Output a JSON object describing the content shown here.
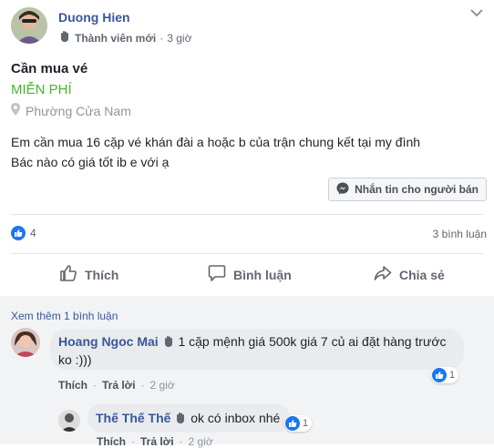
{
  "post": {
    "author": "Duong Hien",
    "role": "Thành viên mới",
    "time": "3 giờ"
  },
  "listing": {
    "title": "Cần mua vé",
    "price": "MIỄN PHÍ",
    "location": "Phường Cửa Nam",
    "body_line1": "Em cần mua 16 cặp vé khán đài a hoặc b của trận chung kết tại my đình",
    "body_line2": "Bác nào có giá tốt ib e với ạ",
    "message_button": "Nhắn tin cho người bán"
  },
  "stats": {
    "reactions": "4",
    "comments": "3 bình luận"
  },
  "actions": {
    "like": "Thích",
    "comment": "Bình luận",
    "share": "Chia sẻ"
  },
  "comments": {
    "more": "Xem thêm 1 bình luận",
    "items": [
      {
        "author": "Hoang Ngoc Mai",
        "text_line1": "1 cặp mệnh giá 500k giá 7 củ ai đặt hàng trước",
        "text_line2": "ko :)))",
        "like_label": "Thích",
        "reply_label": "Trả lời",
        "time": "2 giờ",
        "reactions": "1"
      },
      {
        "author": "Thế Thế Thế",
        "text": "ok có inbox nhé",
        "like_label": "Thích",
        "reply_label": "Trả lời",
        "time": "2 giờ",
        "reactions": "1"
      }
    ]
  },
  "colors": {
    "link": "#385898",
    "price": "#42b72a",
    "like": "#1877f2"
  },
  "icons": [
    "wave-icon",
    "chevron-down-icon",
    "location-pin-icon",
    "messenger-icon",
    "like-icon",
    "comment-icon",
    "share-icon"
  ]
}
